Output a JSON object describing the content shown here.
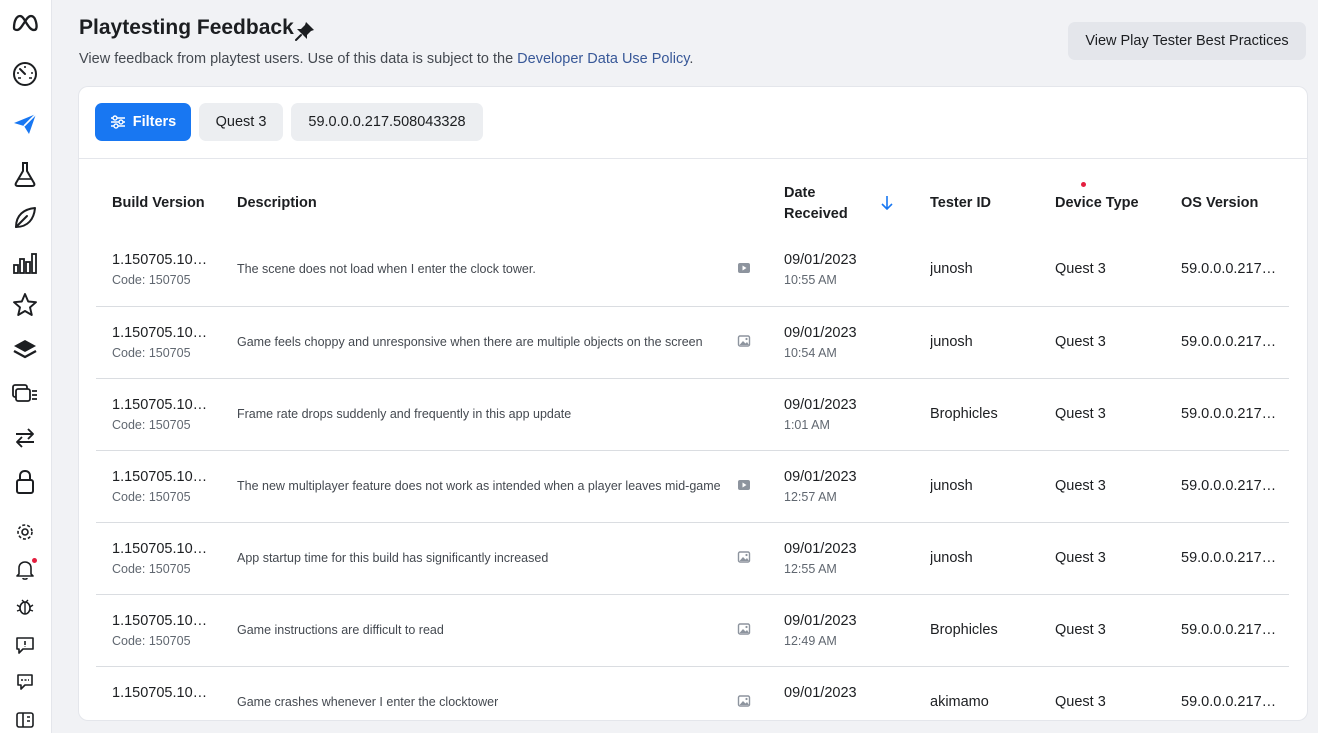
{
  "header": {
    "title": "Playtesting Feedback",
    "subtitle_text": "View feedback from playtest users. Use of this data is subject to the ",
    "policy_link": "Developer Data Use Policy",
    "subtitle_end": ".",
    "best_practices_button": "View Play Tester Best Practices"
  },
  "sidebar": {
    "icons": [
      "meta-logo-icon",
      "dashboard-gauge-icon",
      "send-icon",
      "flask-icon",
      "leaf-icon",
      "bar-chart-icon",
      "star-icon",
      "layers-icon",
      "media-library-icon",
      "transfer-arrows-icon",
      "lock-icon",
      "settings-gear-icon",
      "notifications-bell-icon",
      "bug-icon",
      "feedback-icon",
      "chat-icon",
      "switch-panel-icon"
    ],
    "active": "send-icon"
  },
  "filters": {
    "button_label": "Filters",
    "chips": [
      "Quest 3",
      "59.0.0.0.217.508043328"
    ]
  },
  "table": {
    "headers": {
      "build": "Build Version",
      "description": "Description",
      "date_line1": "Date",
      "date_line2": "Received",
      "tester": "Tester ID",
      "device": "Device Type",
      "os": "OS Version"
    },
    "rows": [
      {
        "build": "1.150705.10…",
        "code": "Code: 150705",
        "description": "The scene does not load when I enter the clock tower.",
        "media": "video",
        "date": "09/01/2023",
        "time": "10:55 AM",
        "tester": "junosh",
        "device": "Quest 3",
        "os": "59.0.0.0.217…"
      },
      {
        "build": "1.150705.10…",
        "code": "Code: 150705",
        "description": "Game feels choppy and unresponsive when there are multiple objects on the screen",
        "media": "image",
        "date": "09/01/2023",
        "time": "10:54 AM",
        "tester": "junosh",
        "device": "Quest 3",
        "os": "59.0.0.0.217…"
      },
      {
        "build": "1.150705.10…",
        "code": "Code: 150705",
        "description": "Frame rate drops suddenly and frequently in this app update",
        "media": "none",
        "date": "09/01/2023",
        "time": "1:01 AM",
        "tester": "Brophicles",
        "device": "Quest 3",
        "os": "59.0.0.0.217…"
      },
      {
        "build": "1.150705.10…",
        "code": "Code: 150705",
        "description": "The new multiplayer feature does not work as intended when a player leaves mid-game",
        "media": "video",
        "date": "09/01/2023",
        "time": "12:57 AM",
        "tester": "junosh",
        "device": "Quest 3",
        "os": "59.0.0.0.217…"
      },
      {
        "build": "1.150705.10…",
        "code": "Code: 150705",
        "description": "App startup time for this build has significantly increased",
        "media": "image",
        "date": "09/01/2023",
        "time": "12:55 AM",
        "tester": "junosh",
        "device": "Quest 3",
        "os": "59.0.0.0.217…"
      },
      {
        "build": "1.150705.10…",
        "code": "Code: 150705",
        "description": "Game instructions are difficult to read",
        "media": "image",
        "date": "09/01/2023",
        "time": "12:49 AM",
        "tester": "Brophicles",
        "device": "Quest 3",
        "os": "59.0.0.0.217…"
      },
      {
        "build": "1.150705.10…",
        "code": "",
        "description": "Game crashes whenever I enter the clocktower",
        "media": "image",
        "date": "09/01/2023",
        "time": "",
        "tester": "akimamo",
        "device": "Quest 3",
        "os": "59.0.0.0.217…"
      }
    ]
  },
  "colors": {
    "accent": "#1877f2",
    "link": "#385898",
    "notification_dot": "#e41e3f"
  }
}
